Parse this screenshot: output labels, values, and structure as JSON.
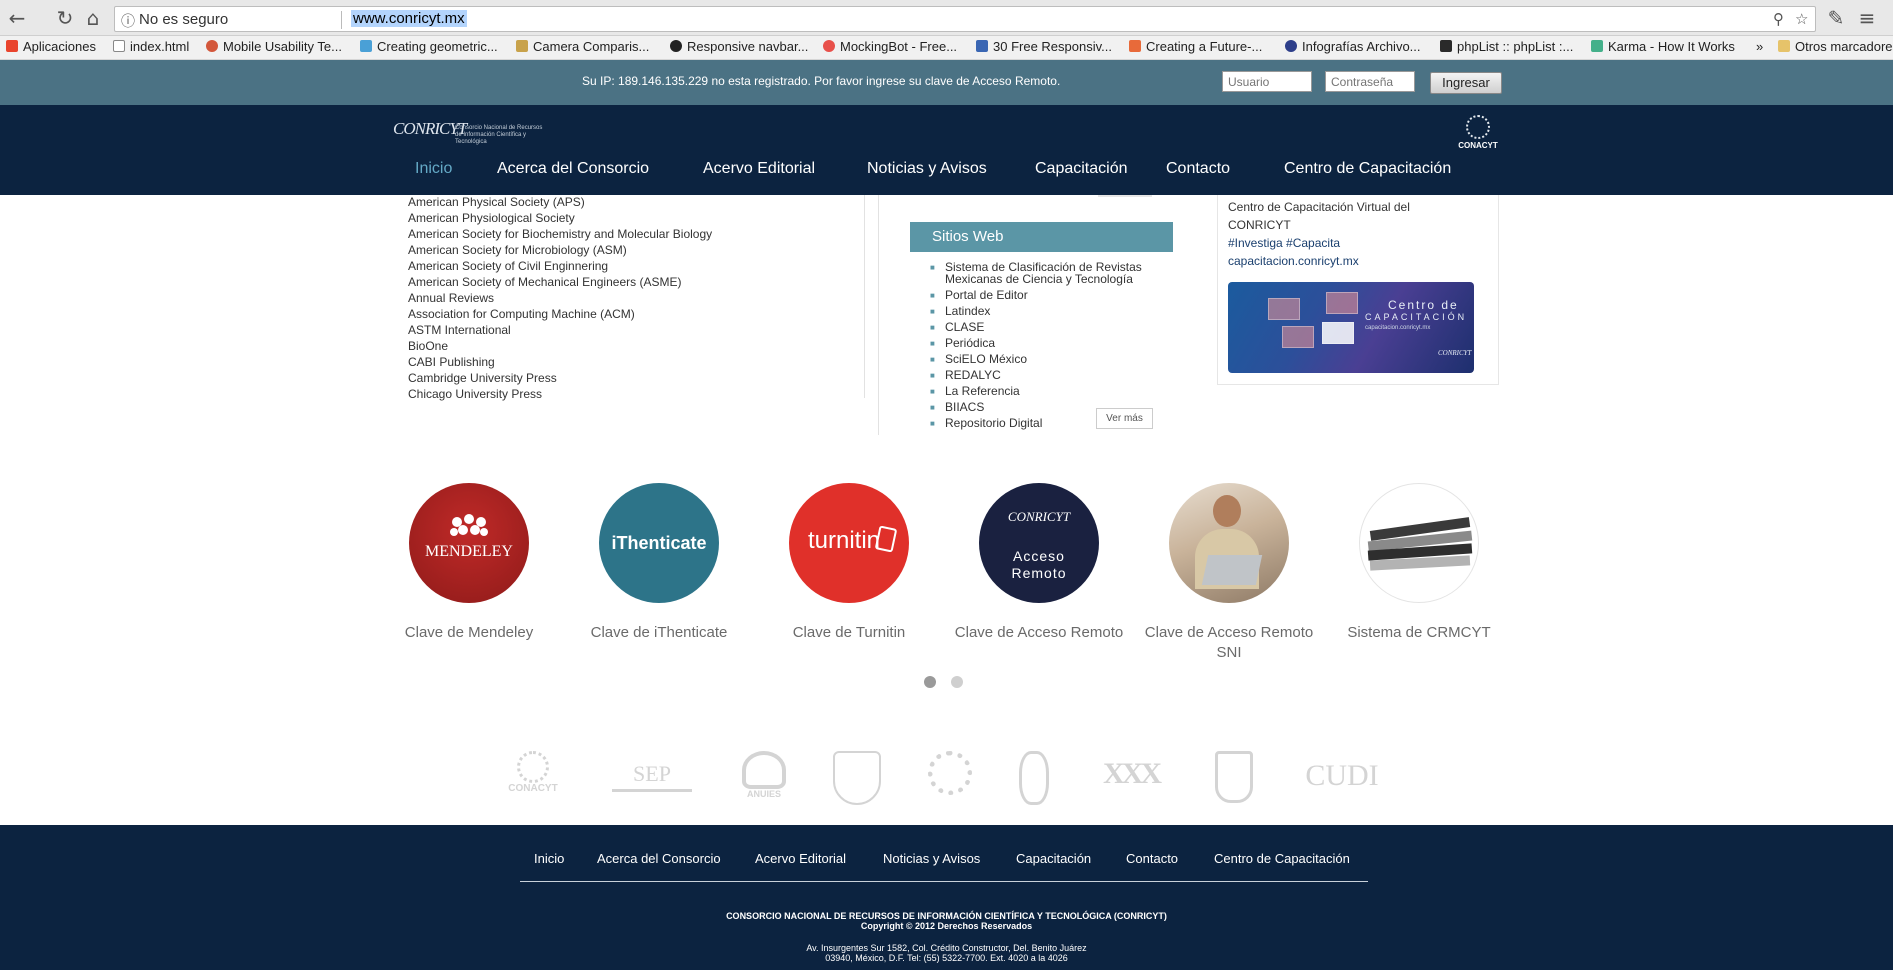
{
  "browser": {
    "not_secure_label": "No es seguro",
    "url": "www.conricyt.mx",
    "info_icon": "info-icon",
    "bookmarks": [
      {
        "label": "Aplicaciones",
        "color": "#e9442d"
      },
      {
        "label": "index.html",
        "color": "#ffffff"
      },
      {
        "label": "Mobile Usability Te...",
        "color": "#d3573b"
      },
      {
        "label": "Creating geometric...",
        "color": "#4aa0d6"
      },
      {
        "label": "Camera Comparis...",
        "color": "#c8a24b"
      },
      {
        "label": "Responsive navbar...",
        "color": "#222222"
      },
      {
        "label": "MockingBot - Free...",
        "color": "#e8504a"
      },
      {
        "label": "30 Free Responsiv...",
        "color": "#3a66b3"
      },
      {
        "label": "Creating a Future-...",
        "color": "#e86a3a"
      },
      {
        "label": "Infografías Archivo...",
        "color": "#2d3e8a"
      },
      {
        "label": "phpList :: phpList :...",
        "color": "#2a2a2a"
      },
      {
        "label": "Karma - How It Works",
        "color": "#44b08a"
      },
      {
        "label": "»",
        "color": ""
      },
      {
        "label": "Otros marcadores",
        "color": "#e6c36a"
      }
    ]
  },
  "ip_bar": {
    "message": "Su IP: 189.146.135.229 no esta registrado. Por favor ingrese su clave de Acceso Remoto.",
    "user_placeholder": "Usuario",
    "password_placeholder": "Contraseña",
    "submit_label": "Ingresar"
  },
  "header": {
    "logo_mark": "CONRICYT",
    "logo_text": "Consorcio Nacional de Recursos de Información Científica y Tecnológica",
    "conacyt_label": "CONACYT",
    "nav": [
      "Inicio",
      "Acerca del Consorcio",
      "Acervo Editorial",
      "Noticias y Avisos",
      "Capacitación",
      "Contacto",
      "Centro de Capacitación"
    ]
  },
  "publishers": [
    "American Physical Society (APS)",
    "American Physiological Society",
    "American Society for Biochemistry and Molecular Biology",
    "American Society for Microbiology (ASM)",
    "American Society of Civil Enginnering",
    "American Society of Mechanical Engineers (ASME)",
    "Annual Reviews",
    "Association for Computing Machine (ACM)",
    "ASTM International",
    "BioOne",
    "CABI Publishing",
    "Cambridge University Press",
    "Chicago University Press"
  ],
  "sitios": {
    "title": "Sitios Web",
    "items": [
      "Sistema de Clasificación de Revistas Mexicanas de Ciencia y Tecnología",
      "Portal de Editor",
      "Latindex",
      "CLASE",
      "Periódica",
      "SciELO México",
      "REDALYC",
      "La Referencia",
      "BIIACS",
      "Repositorio Digital"
    ],
    "more_label": "Ver más"
  },
  "right_box": {
    "line1": "Centro de Capacitación Virtual del",
    "line2": "CONRICYT",
    "hashtags": "#Investiga #Capacita",
    "link": "capacitacion.conricyt.mx",
    "banner": {
      "title": "Centro de",
      "subtitle": "CAPACITACIÓN",
      "url": "capacitacion.conricyt.mx",
      "mark": "CONRICYT"
    }
  },
  "tiles": [
    {
      "label": "Clave de Mendeley",
      "logo": "MENDELEY",
      "color": "#a3201f"
    },
    {
      "label": "Clave de iThenticate",
      "logo": "iThenticate",
      "color": "#2d7489"
    },
    {
      "label": "Clave de Turnitin",
      "logo": "turnitin",
      "color": "#e0302a"
    },
    {
      "label": "Clave de Acceso Remoto",
      "logo_mark": "CONRICYT",
      "logo_line1": "Acceso",
      "logo_line2": "Remoto",
      "color": "#1a2140"
    },
    {
      "label": "Clave de Acceso Remoto SNI",
      "logo": "",
      "color": "#c9b39a"
    },
    {
      "label": "Sistema de CRMCYT",
      "logo": "",
      "color": "#dddddd"
    }
  ],
  "carousel": {
    "active_index": 0,
    "count": 2
  },
  "partners": [
    "CONACYT",
    "SEP",
    "ANUIES",
    "UNAM",
    "CINVESTAV",
    "IPN",
    "UAM",
    "UdeG",
    "CUDI"
  ],
  "footer": {
    "nav": [
      "Inicio",
      "Acerca del Consorcio",
      "Acervo Editorial",
      "Noticias y Avisos",
      "Capacitación",
      "Contacto",
      "Centro de Capacitación"
    ],
    "copy_line1": "CONSORCIO NACIONAL DE RECURSOS DE INFORMACIÓN CIENTÍFICA Y TECNOLÓGICA (CONRICYT)",
    "copy_line2": "Copyright © 2012 Derechos Reservados",
    "addr_line1": "Av. Insurgentes Sur 1582, Col. Crédito Constructor, Del. Benito Juárez",
    "addr_line2": "03940, México, D.F. Tel: (55) 5322-7700. Ext. 4020 a la 4026"
  }
}
